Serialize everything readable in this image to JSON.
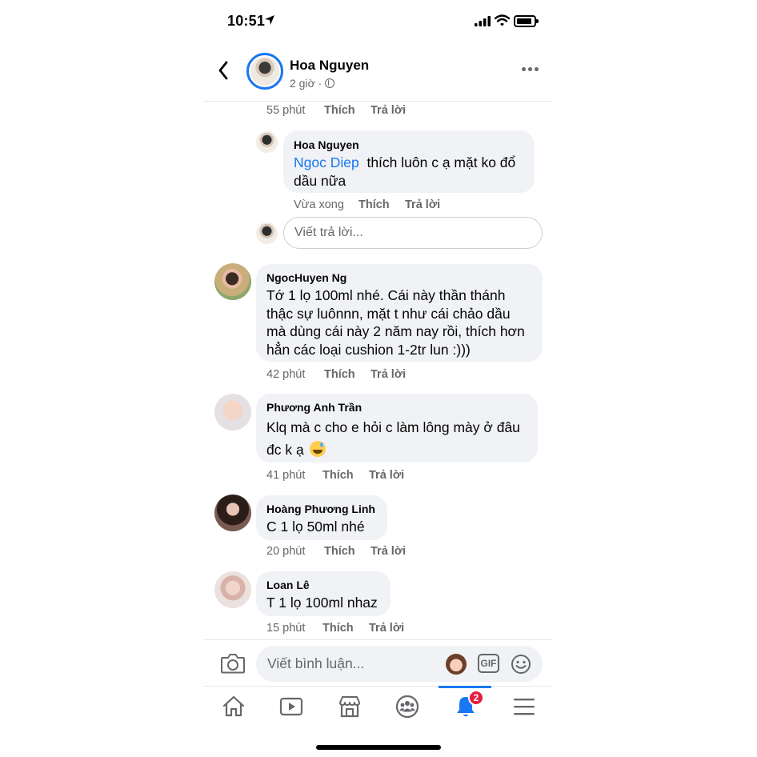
{
  "status_bar": {
    "time": "10:51"
  },
  "header": {
    "name": "Hoa Nguyen",
    "meta": "2 giờ ·"
  },
  "top_actions": {
    "time": "55 phút",
    "like": "Thích",
    "reply": "Trả lời"
  },
  "comments": [
    {
      "name": "Hoa Nguyen",
      "mention": "Ngoc Diep",
      "text_lines": [
        "thích luôn c ạ mặt ko đổ",
        "dầu nữa"
      ],
      "time": "Vừa xong",
      "like": "Thích",
      "reply": "Trả lời"
    },
    {
      "name": "NgocHuyen Ng",
      "text_lines": [
        "Tớ 1 lọ 100ml nhé. Cái này thần thánh",
        "thậc sự luônnn, mặt t như cái chảo dầu",
        "mà dùng cái này 2 năm nay rồi, thích hơn",
        "hẳn các loại cushion 1-2tr lun :)))"
      ],
      "time": "42 phút",
      "like": "Thích",
      "reply": "Trả lời"
    },
    {
      "name": "Phương Anh Trần",
      "text_lines": [
        "Klq mà c cho e hỏi c làm lông mày ở đâu",
        "đc k ạ"
      ],
      "emoji": "sweat-smile-emoji",
      "time": "41 phút",
      "like": "Thích",
      "reply": "Trả lời"
    },
    {
      "name": "Hoàng Phương Linh",
      "text_lines": [
        "C 1 lọ 50ml nhé"
      ],
      "time": "20 phút",
      "like": "Thích",
      "reply": "Trả lời"
    },
    {
      "name": "Loan Lê",
      "text_lines": [
        "T 1 lọ 100ml nhaz"
      ],
      "time": "15 phút",
      "like": "Thích",
      "reply": "Trả lời"
    }
  ],
  "reply_input": {
    "placeholder": "Viết trả lời..."
  },
  "comment_input": {
    "placeholder": "Viết bình luận...",
    "gif_label": "GIF"
  },
  "nav": {
    "items": [
      "home-icon",
      "watch-icon",
      "marketplace-icon",
      "groups-icon",
      "notifications-icon",
      "menu-icon"
    ],
    "active": "notifications-icon",
    "notification_badge": "2"
  },
  "colors": {
    "accent": "#1877f2",
    "bubble": "#f0f2f5",
    "muted": "#65676b",
    "badge": "#e41e3f"
  }
}
